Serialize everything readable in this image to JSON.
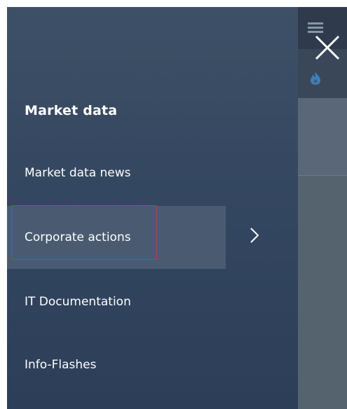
{
  "menu": {
    "section_title": "Market data",
    "items": [
      {
        "label": "Market data news",
        "active": false
      },
      {
        "label": "Corporate actions",
        "active": true,
        "has_submenu": true
      },
      {
        "label": "IT Documentation",
        "active": false
      },
      {
        "label": "Info-Flashes",
        "active": false
      }
    ]
  },
  "icons": {
    "close": "close-icon",
    "chevron": "chevron-right-icon",
    "hamburger": "hamburger-menu-icon",
    "logo": "flame-logo-icon"
  },
  "colors": {
    "flyout_background": "#344760",
    "active_item_background": "#4a5b71",
    "highlight_outline": "#c0394b",
    "text": "#ffffff"
  }
}
